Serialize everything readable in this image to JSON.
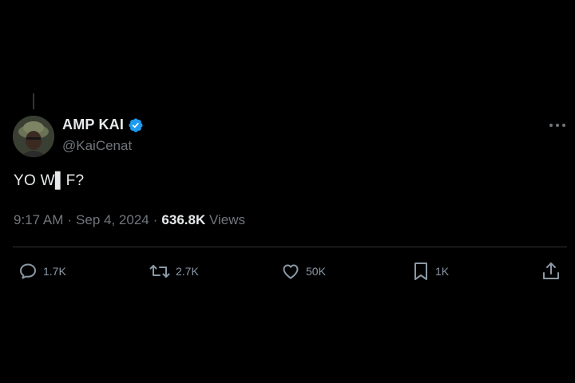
{
  "tweet": {
    "author": {
      "display_name": "AMP KAI",
      "handle": "@KaiCenat",
      "verified": true,
      "avatar_icon": "avatar-photo"
    },
    "text": "YO W▌F?",
    "meta": {
      "time": "9:17 AM",
      "date": "Sep 4, 2024",
      "separator": "·",
      "views_count": "636.8K",
      "views_label": "Views"
    },
    "actions": {
      "replies": "1.7K",
      "reposts": "2.7K",
      "likes": "50K",
      "bookmarks": "1K"
    }
  },
  "colors": {
    "background": "#000000",
    "primary_text": "#e7e9ea",
    "secondary_text": "#71767b",
    "verified_badge": "#1d9bf0",
    "divider": "#2f3336"
  },
  "icons": {
    "verified": "verified-badge-icon",
    "more": "more-horizontal-icon",
    "reply": "reply-icon",
    "repost": "repost-icon",
    "like": "heart-icon",
    "bookmark": "bookmark-icon",
    "share": "share-icon"
  }
}
